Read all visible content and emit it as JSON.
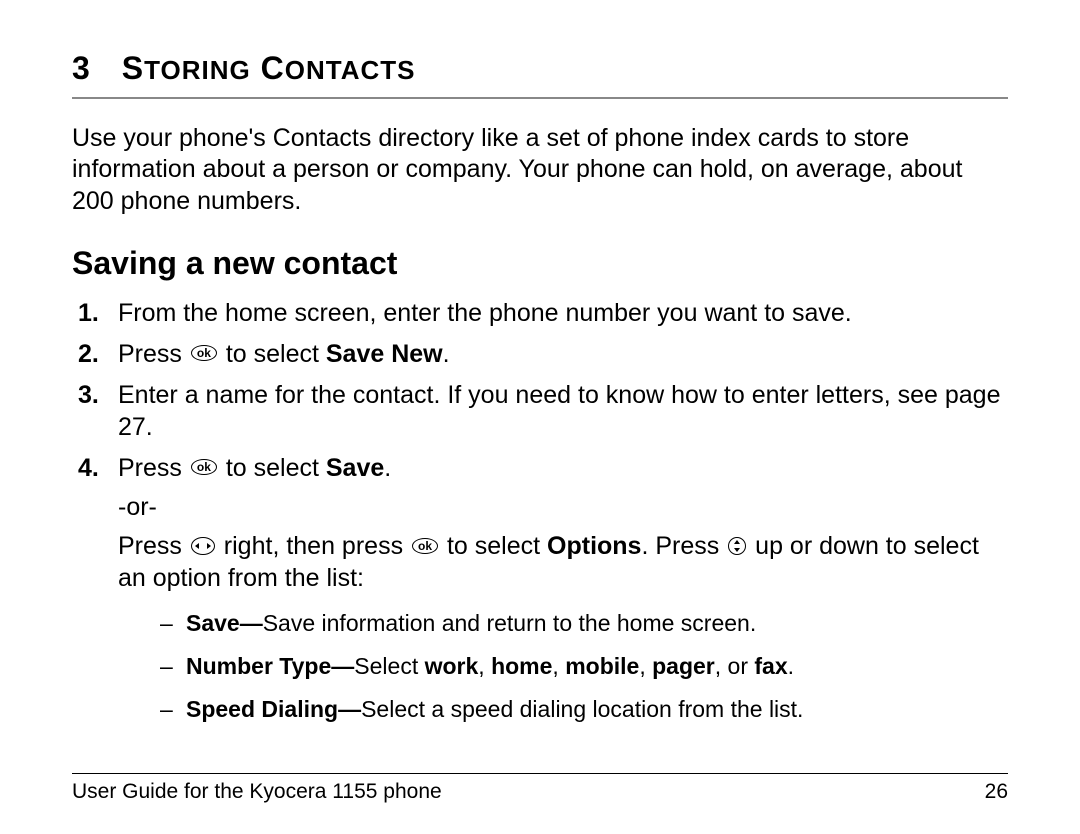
{
  "chapter": {
    "number": "3",
    "title_start": "S",
    "title_rest1": "TORING",
    "title_sep": " C",
    "title_rest2": "ONTACTS"
  },
  "intro": "Use your phone's Contacts directory like a set of phone index cards to store information about a person or company. Your phone can hold, on average, about 200 phone numbers.",
  "section_heading": "Saving a new contact",
  "steps": {
    "s1": "From the home screen, enter the phone number you want to save.",
    "s2_prefix": "Press ",
    "s2_mid": " to select ",
    "s2_bold": "Save New",
    "s2_end": ".",
    "s3": "Enter a name for the contact. If you need to know how to enter letters, see page 27.",
    "s4_prefix": "Press ",
    "s4_mid": " to select ",
    "s4_bold": "Save",
    "s4_end": ".",
    "s4_or": "-or-",
    "s4b_p1": "Press ",
    "s4b_p2": " right, then press ",
    "s4b_p3": " to select ",
    "s4b_bold": "Options",
    "s4b_p4": ". Press ",
    "s4b_p5": " up or down to select an option from the list:"
  },
  "sub": {
    "save_bold": "Save—",
    "save_rest": "Save information and return to the home screen.",
    "numtype_bold": "Number Type—",
    "numtype_p1": "Select ",
    "numtype_w": "work",
    "numtype_c1": ", ",
    "numtype_h": "home",
    "numtype_c2": ", ",
    "numtype_m": "mobile",
    "numtype_c3": ", ",
    "numtype_p": "pager",
    "numtype_c4": ", or ",
    "numtype_f": "fax",
    "numtype_end": ".",
    "speed_bold": "Speed Dialing—",
    "speed_rest": "Select a speed dialing location from the list."
  },
  "footer": {
    "left": "User Guide for the Kyocera 1155 phone",
    "right": "26"
  },
  "icons": {
    "ok": "ok"
  }
}
